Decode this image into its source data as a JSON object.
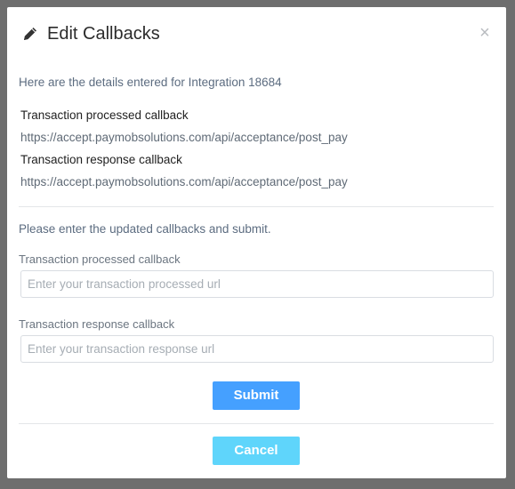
{
  "modal": {
    "title": "Edit Callbacks",
    "close_glyph": "×",
    "title_icon": "pencil-icon",
    "close_icon": "close-icon"
  },
  "details": {
    "intro": "Here are the details entered for Integration 18684",
    "processed_label": "Transaction processed callback",
    "processed_value": "https://accept.paymobsolutions.com/api/acceptance/post_pay",
    "response_label": "Transaction response callback",
    "response_value": "https://accept.paymobsolutions.com/api/acceptance/post_pay"
  },
  "form": {
    "prompt": "Please enter the updated callbacks and submit.",
    "processed_label": "Transaction processed callback",
    "processed_placeholder": "Enter your transaction processed url",
    "processed_value": "",
    "response_label": "Transaction response callback",
    "response_placeholder": "Enter your transaction response url",
    "response_value": "",
    "submit_label": "Submit",
    "cancel_label": "Cancel"
  },
  "colors": {
    "submit": "#45a0ff",
    "cancel": "#5fd5fb",
    "backdrop": "#6e6e6e"
  }
}
